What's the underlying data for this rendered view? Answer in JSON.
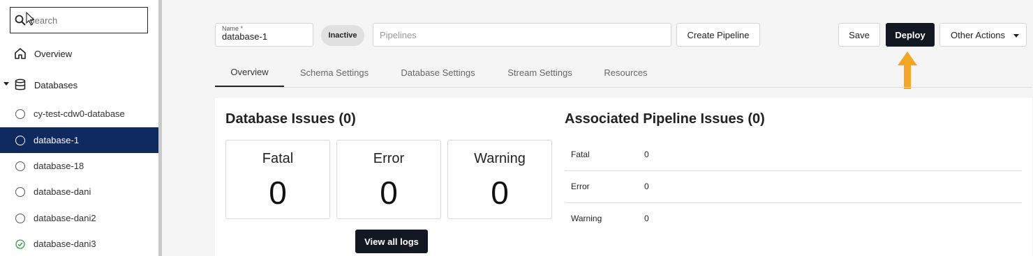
{
  "sidebar": {
    "search": {
      "placeholder": "Search",
      "icon": "search-icon"
    },
    "overview": {
      "label": "Overview",
      "icon": "home-icon"
    },
    "databases": {
      "label": "Databases",
      "icon": "database-icon"
    },
    "items": [
      {
        "label": "cy-test-cdw0-database",
        "status": "inactive"
      },
      {
        "label": "database-1",
        "status": "inactive",
        "selected": true
      },
      {
        "label": "database-18",
        "status": "inactive"
      },
      {
        "label": "database-dani",
        "status": "inactive"
      },
      {
        "label": "database-dani2",
        "status": "inactive"
      },
      {
        "label": "database-dani3",
        "status": "active"
      }
    ]
  },
  "header": {
    "name_label": "Name *",
    "name_value": "database-1",
    "status_badge": "Inactive",
    "pipelines_placeholder": "Pipelines",
    "create_pipeline": "Create Pipeline",
    "save": "Save",
    "deploy": "Deploy",
    "other_actions": "Other Actions"
  },
  "tabs": [
    {
      "label": "Overview",
      "active": true
    },
    {
      "label": "Schema Settings"
    },
    {
      "label": "Database Settings"
    },
    {
      "label": "Stream Settings"
    },
    {
      "label": "Resources"
    }
  ],
  "database_issues": {
    "title": "Database Issues (0)",
    "cards": [
      {
        "label": "Fatal",
        "value": "0"
      },
      {
        "label": "Error",
        "value": "0"
      },
      {
        "label": "Warning",
        "value": "0"
      }
    ],
    "view_logs": "View all logs"
  },
  "pipeline_issues": {
    "title": "Associated Pipeline Issues (0)",
    "rows": [
      {
        "label": "Fatal",
        "value": "0"
      },
      {
        "label": "Error",
        "value": "0"
      },
      {
        "label": "Warning",
        "value": "0"
      }
    ]
  },
  "colors": {
    "selected_bg": "#0f2a5e",
    "primary_button": "#131722",
    "annotation_arrow": "#f5a623",
    "active_check": "#2e9e4f"
  }
}
